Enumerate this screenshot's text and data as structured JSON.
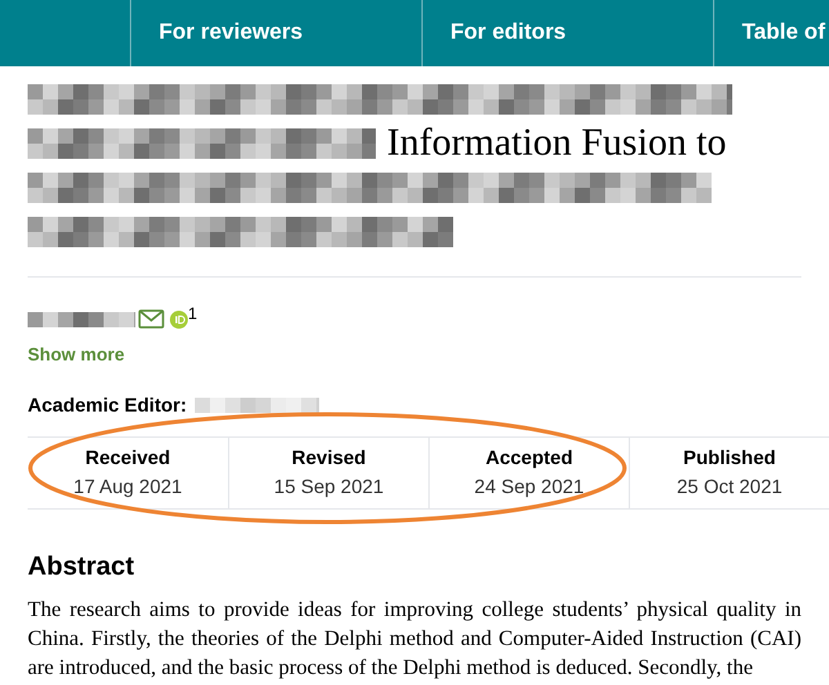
{
  "nav": {
    "items": [
      {
        "label": "For reviewers"
      },
      {
        "label": "For editors"
      },
      {
        "label": "Table of"
      }
    ]
  },
  "title": {
    "lines": [
      [
        {
          "kind": "redacted"
        }
      ],
      [
        {
          "kind": "redacted"
        },
        {
          "kind": "text",
          "text": "Information Fusion to"
        }
      ],
      [
        {
          "kind": "redacted"
        }
      ],
      [
        {
          "kind": "redacted"
        }
      ]
    ]
  },
  "authors": [
    {
      "kind": "redacted",
      "email": true,
      "orcid": true,
      "affiliation": "1"
    }
  ],
  "show_more": "Show more",
  "academic_editor": {
    "label": "Academic Editor:",
    "kind": "redacted"
  },
  "dates": [
    {
      "label": "Received",
      "date": "17 Aug 2021"
    },
    {
      "label": "Revised",
      "date": "15 Sep 2021"
    },
    {
      "label": "Accepted",
      "date": "24 Sep 2021"
    },
    {
      "label": "Published",
      "date": "25 Oct 2021"
    }
  ],
  "highlight": {
    "on": true
  },
  "abstract": {
    "heading": "Abstract",
    "text": "The research aims to provide ideas for improving college students’ physical quality in China. Firstly, the theories of the Delphi method and Computer-Aided Instruction (CAI) are introduced, and the basic process of the Delphi method is deduced. Secondly, the"
  }
}
